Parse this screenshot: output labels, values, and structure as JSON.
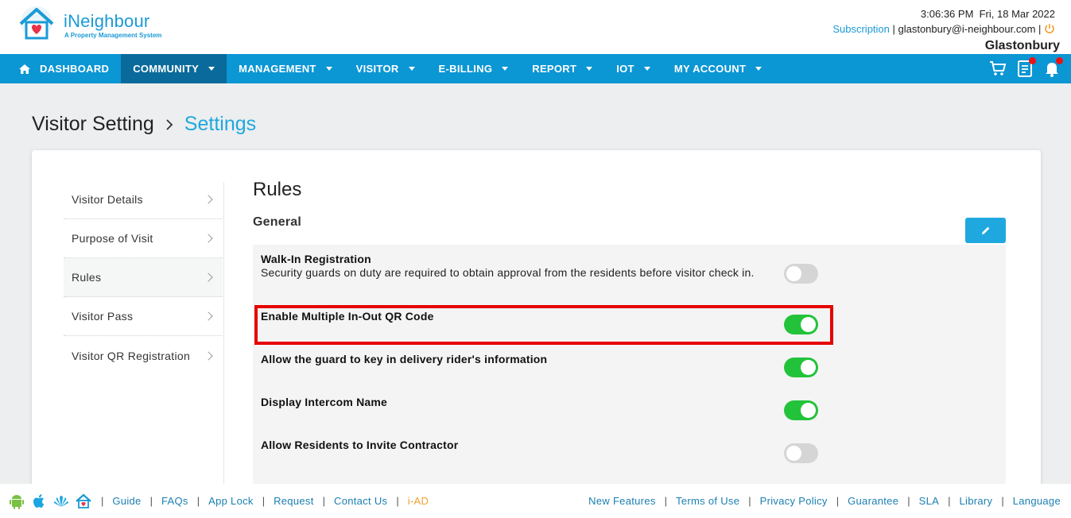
{
  "header": {
    "brand_name": "iNeighbour",
    "brand_tagline": "A Property Management System",
    "datetime": "3:06:36 PM  Fri, 18 Mar 2022",
    "subscription_label": "Subscription",
    "account_email": " | glastonbury@i-neighbour.com | ",
    "site_name": "Glastonbury"
  },
  "nav": {
    "items": [
      {
        "label": "DASHBOARD"
      },
      {
        "label": "COMMUNITY"
      },
      {
        "label": "MANAGEMENT"
      },
      {
        "label": "VISITOR"
      },
      {
        "label": "E-BILLING"
      },
      {
        "label": "REPORT"
      },
      {
        "label": "IOT"
      },
      {
        "label": "MY ACCOUNT"
      }
    ],
    "active": "COMMUNITY"
  },
  "breadcrumb": {
    "root": "Visitor Setting",
    "current": "Settings"
  },
  "side_menu": {
    "items": [
      {
        "label": "Visitor Details"
      },
      {
        "label": "Purpose of Visit"
      },
      {
        "label": "Rules"
      },
      {
        "label": "Visitor Pass"
      },
      {
        "label": "Visitor QR Registration"
      }
    ]
  },
  "content": {
    "title": "Rules",
    "section_title": "General",
    "rules": [
      {
        "title": "Walk-In Registration",
        "description": "Security guards on duty are required to obtain approval from the residents before visitor check in.",
        "enabled": false
      },
      {
        "title": "Enable Multiple In-Out QR Code",
        "description": "",
        "enabled": true
      },
      {
        "title": "Allow the guard to key in delivery rider's information",
        "description": "",
        "enabled": true
      },
      {
        "title": "Display Intercom Name",
        "description": "",
        "enabled": true
      },
      {
        "title": "Allow Residents to Invite Contractor",
        "description": "",
        "enabled": false
      }
    ]
  },
  "footer": {
    "left_links": [
      "Guide",
      "FAQs",
      "App Lock",
      "Request",
      "Contact Us",
      "i-AD"
    ],
    "right_links": [
      "New Features",
      "Terms of Use",
      "Privacy Policy",
      "Guarantee",
      "SLA",
      "Library",
      "Language"
    ]
  },
  "colors": {
    "brand": "#1b9ad6",
    "nav_bg": "#0b96d4",
    "nav_active": "#0a6a9b",
    "toggle_on": "#22c33a",
    "highlight": "#e60000",
    "accent_link": "#1fa8df"
  }
}
